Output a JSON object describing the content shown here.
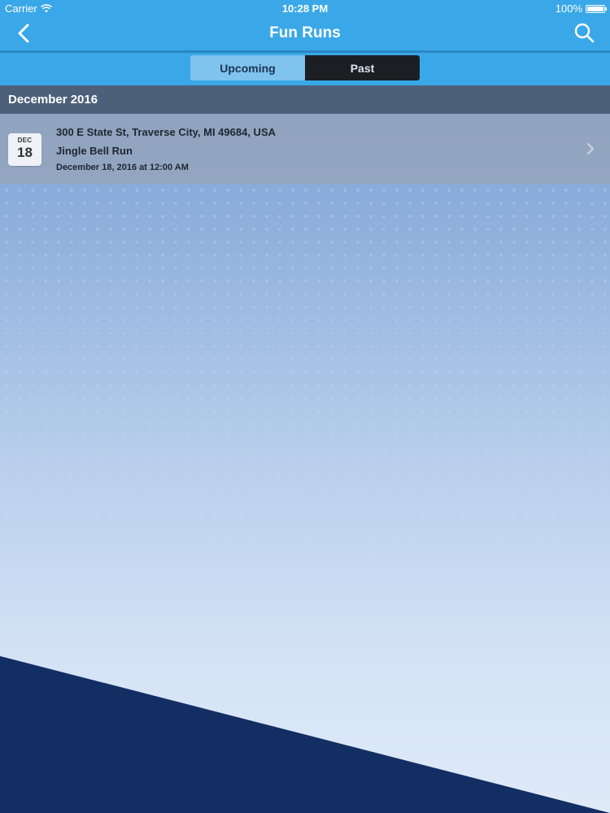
{
  "status_bar": {
    "carrier": "Carrier",
    "time": "10:28 PM",
    "battery": "100%",
    "battery_level": 1.0
  },
  "nav": {
    "title": "Fun Runs",
    "back_icon": "chevron-left-icon",
    "search_icon": "search-icon"
  },
  "segments": {
    "upcoming": "Upcoming",
    "past": "Past",
    "selected": "Past"
  },
  "section": {
    "title": "December 2016"
  },
  "events": [
    {
      "month": "DEC",
      "day": "18",
      "address": "300 E State St, Traverse City, MI 49684, USA",
      "name": "Jingle Bell Run",
      "datetime": "December 18, 2016 at 12:00 AM"
    }
  ],
  "colors": {
    "nav_blue": "#3aa8e8",
    "segment_selected": "#1b1e22",
    "segment_unselected": "#7fc3ef",
    "section_header": "#4c607a",
    "dark_navy": "#132e63"
  }
}
